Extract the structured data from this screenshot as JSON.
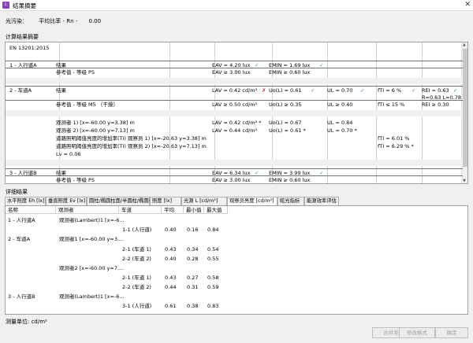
{
  "window": {
    "title": "结果摘要",
    "icon": "app-icon",
    "close": "✕"
  },
  "lighting": {
    "label": "光污染：",
    "ratio_label": "平均比率 - Rn -",
    "ratio_value": "0.00"
  },
  "summary_section_label": "计算结果摘要",
  "summary": {
    "standard": "EN 13201:2015",
    "rows": [
      {
        "type": "main",
        "name": "1 - 人行道A",
        "kind": "结果",
        "eav": "EAV = 4.20 lux",
        "eav_ok": "✓",
        "emin": "EMIN = 1.69 lux",
        "emin_ok": "✓"
      },
      {
        "type": "sub",
        "kind": "参考值 - 等级 P5",
        "eav": "EAV ≥ 3.00 lux",
        "emin": "EMIN ≥ 0.60 lux"
      },
      {
        "type": "main",
        "name": "2 - 车道A",
        "kind": "结果",
        "lav": "LAV = 0.42 cd/m²",
        "lav_mark": "✗",
        "uo": "Uo(L) = 0.61",
        "uo_ok": "✓",
        "ul": "UL = 0.70",
        "ul_ok": "✓",
        "fti": "fTI = 6 %",
        "fti_ok": "✓",
        "rei": "REI = 0.63",
        "rei_ok": "✓",
        "extra": "R=0.63 L=0.78"
      },
      {
        "type": "sub",
        "kind": "参考值 - 等级 M5 （干燥）",
        "lav": "LAV ≥ 0.50 cd/m²",
        "uo": "Uo(L) ≥ 0.35",
        "ul": "UL ≥ 0.40",
        "fti": "fTI ≤ 15 %",
        "rei": "REI ≥ 0.30"
      },
      {
        "type": "obs",
        "label": "观测者 1) [x=-60.00 y=3.38] m",
        "lav": "LAV = 0.42 cd/m² *",
        "uo": "Uo(L) = 0.67",
        "ul": "UL = 0.84"
      },
      {
        "type": "obs",
        "label": "观测者 2) [x=-60.00 y=7.13] m",
        "lav": "LAV = 0.44 cd/m²",
        "uo": "Uo(L) = 0.61 *",
        "ul": "UL = 0.70 *"
      },
      {
        "type": "obs",
        "label": "道路照明阈值亮度的增加率(TI) 观察员 1) [x=-20.63 y=3.38] m",
        "fti": "fTI = 6.01 %"
      },
      {
        "type": "obs",
        "label": "道路照明阈值亮度的增加率(TI) 观察员 2) [x=-20.63 y=7.13] m",
        "fti": "fTI = 6.29 % *"
      },
      {
        "type": "obs",
        "label": "Lv = 0.06"
      },
      {
        "type": "main",
        "name": "3 - 人行道B",
        "kind": "结果",
        "eav": "EAV = 6.34 lux",
        "eav_ok": "✓",
        "emin": "EMIN = 3.99 lux",
        "emin_ok": "✓"
      },
      {
        "type": "sub",
        "kind": "参考值 - 等级 P5",
        "eav": "EAV ≥ 3.00 lux",
        "emin": "EMIN ≥ 0.60 lux"
      }
    ]
  },
  "detail_section_label": "详细结果",
  "tabs": [
    "水平照度 Eh [lx]",
    "垂直照度 Ev [lx]",
    "圆柱/椭圆柱面/半圆柱/椭圆半圆...",
    "照度 [lx]",
    "光源 L [cd/m²]",
    "观察员亮度 [cd/m²]",
    "眩光指标",
    "能源效率评估"
  ],
  "active_tab": 5,
  "detail": {
    "headers": [
      "名称",
      "观测者",
      "车道",
      "平均",
      "最小值",
      "最大值"
    ],
    "rows": [
      {
        "name": "1 - 人行道A",
        "obs": "观测者(Lambert)1 [x=-6...",
        "lane": "",
        "avg": "",
        "min": "",
        "max": ""
      },
      {
        "name": "",
        "obs": "",
        "lane": "1-1 (人行道)",
        "avg": "0.40",
        "min": "0.16",
        "max": "0.84"
      },
      {
        "name": "2 - 车道A",
        "obs": "观测者1 [x=-60.00 y=3....",
        "lane": "",
        "avg": "",
        "min": "",
        "max": ""
      },
      {
        "name": "",
        "obs": "",
        "lane": "2-1 (车道 1)",
        "avg": "0.43",
        "min": "0.34",
        "max": "0.54"
      },
      {
        "name": "",
        "obs": "",
        "lane": "2-2 (车道 2)",
        "avg": "0.40",
        "min": "0.28",
        "max": "0.55"
      },
      {
        "name": "",
        "obs": "观测者2 [x=-60.00 y=7....",
        "lane": "",
        "avg": "",
        "min": "",
        "max": ""
      },
      {
        "name": "",
        "obs": "",
        "lane": "2-1 (车道 1)",
        "avg": "0.43",
        "min": "0.27",
        "max": "0.58"
      },
      {
        "name": "",
        "obs": "",
        "lane": "2-2 (车道 2)",
        "avg": "0.44",
        "min": "0.31",
        "max": "0.59"
      },
      {
        "name": "3 - 人行道B",
        "obs": "观测者(Lambert)1 [x=-6...",
        "lane": "",
        "avg": "",
        "min": "",
        "max": ""
      },
      {
        "name": "",
        "obs": "",
        "lane": "3-1 (人行道)",
        "avg": "0.61",
        "min": "0.38",
        "max": "0.83"
      }
    ]
  },
  "units": "测量单位: cd/m²",
  "buttons": [
    "合并至",
    "修改格式",
    "确定"
  ]
}
